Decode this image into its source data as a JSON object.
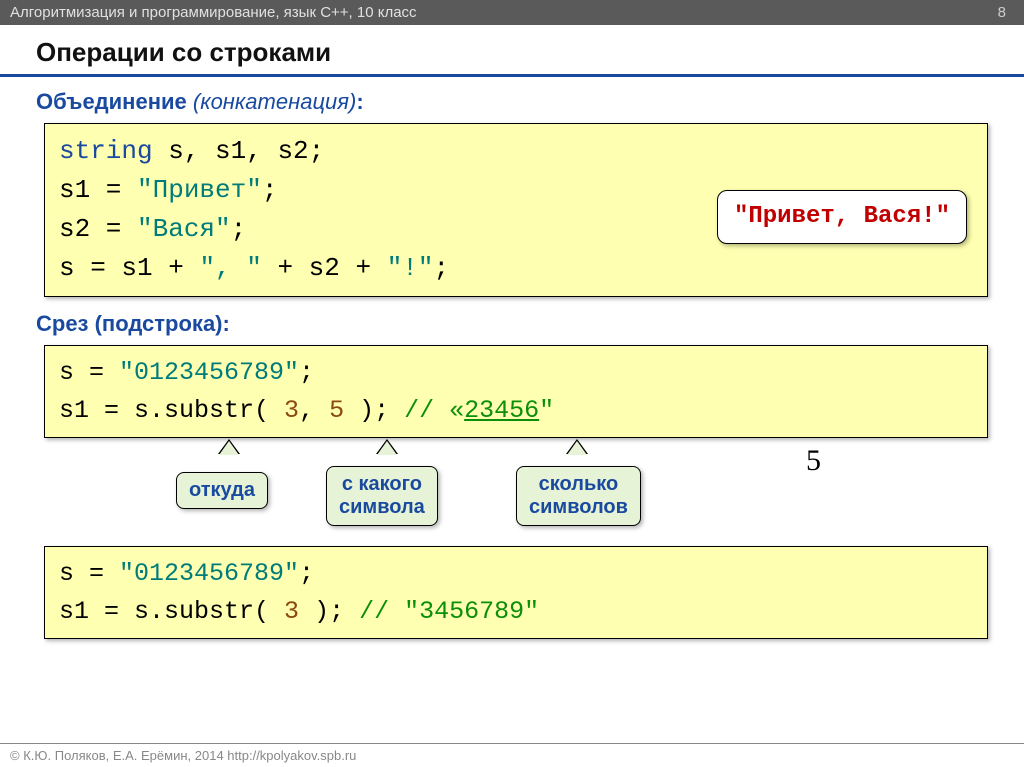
{
  "header": {
    "subject": "Алгоритмизация и программирование, язык C++, 10 класс",
    "page": "8"
  },
  "title": "Операции со строками",
  "section1": {
    "heading_bold": "Объединение",
    "heading_italic": " (конкатенация)",
    "heading_suffix": ":",
    "code_line1_kw": "string",
    "code_line1_rest": " s, s1, s2;",
    "code_line2_pre": "s1 = ",
    "code_line2_str": "\"Привет\"",
    "code_line2_post": ";",
    "code_line3_pre": "s2 = ",
    "code_line3_str": "\"Вася\"",
    "code_line3_post": ";",
    "code_line4_pre": "s = s1 + ",
    "code_line4_str1": "\", \"",
    "code_line4_mid": " + s2 + ",
    "code_line4_str2": "\"!\"",
    "code_line4_post": ";",
    "result": "\"Привет, Вася!\""
  },
  "section2": {
    "heading": "Срез (подстрока):",
    "box1_line1_pre": "s = ",
    "box1_line1_str": "\"0123456789\"",
    "box1_line1_post": ";",
    "box1_line2_pre": "s1 = s.substr( ",
    "box1_line2_arg1": "3",
    "box1_line2_comma": ", ",
    "box1_line2_arg2": "5",
    "box1_line2_post": " );    ",
    "box1_line2_comment_pre": "// «",
    "box1_line2_comment_val": "23456",
    "box1_line2_comment_post": "\"",
    "ann1": "откуда",
    "ann2": "с какого\nсимвола",
    "ann3": "сколько\nсимволов",
    "five": "5",
    "box2_line1_pre": "s = ",
    "box2_line1_str": "\"0123456789\"",
    "box2_line1_post": ";",
    "box2_line2_pre": "s1 = s.substr( ",
    "box2_line2_arg1": "3",
    "box2_line2_post": " );   ",
    "box2_line2_comment": "// \"3456789\""
  },
  "footer": "© К.Ю. Поляков, Е.А. Ерёмин, 2014   http://kpolyakov.spb.ru"
}
